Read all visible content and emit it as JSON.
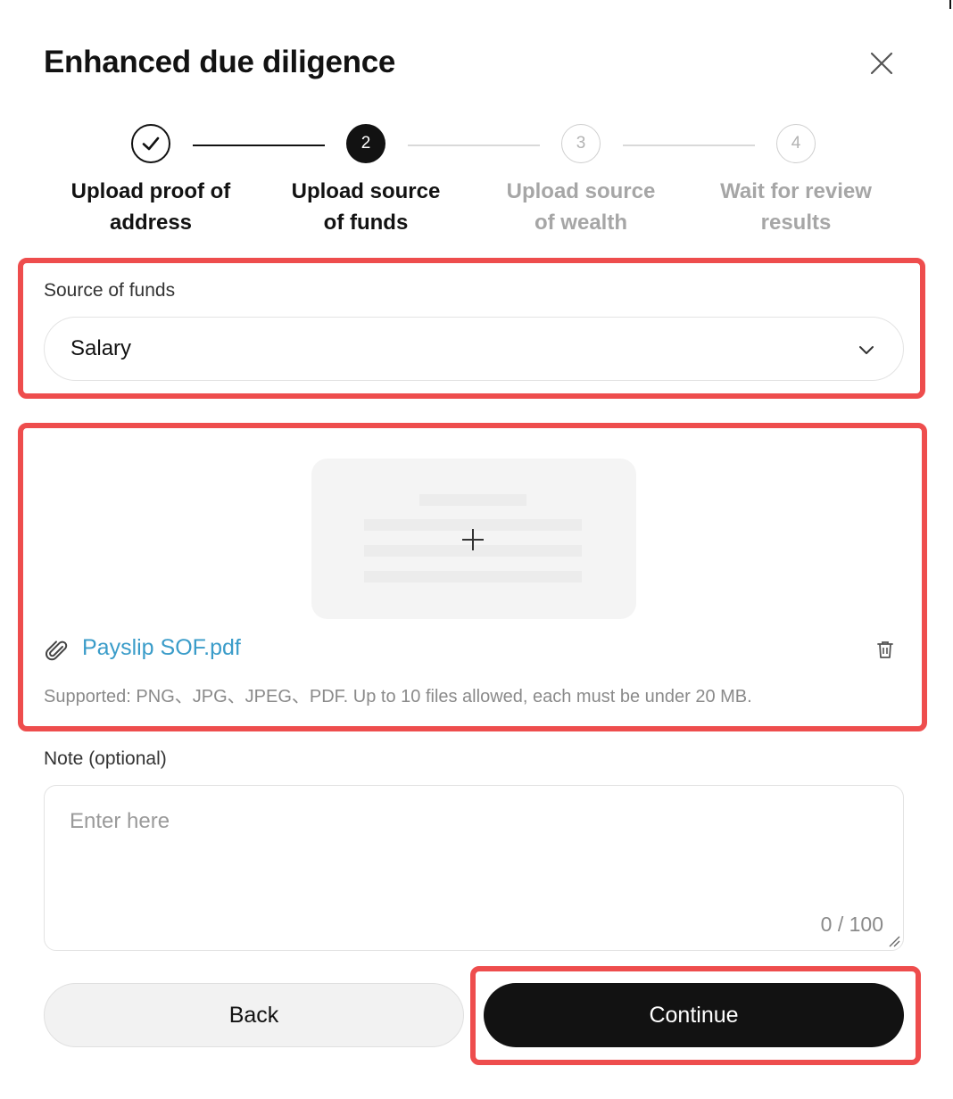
{
  "dialog": {
    "title": "Enhanced due diligence"
  },
  "stepper": {
    "steps": [
      {
        "label_line1": "Upload proof of",
        "label_line2": "address",
        "state": "done",
        "number": "1"
      },
      {
        "label_line1": "Upload source",
        "label_line2": "of funds",
        "state": "active",
        "number": "2"
      },
      {
        "label_line1": "Upload source",
        "label_line2": "of wealth",
        "state": "todo",
        "number": "3"
      },
      {
        "label_line1": "Wait for review",
        "label_line2": "results",
        "state": "todo",
        "number": "4"
      }
    ]
  },
  "source_of_funds": {
    "label": "Source of funds",
    "value": "Salary"
  },
  "upload": {
    "file_name": "Payslip SOF.pdf",
    "supported_text": "Supported: PNG、JPG、JPEG、PDF. Up to 10 files allowed, each must be under 20 MB."
  },
  "note": {
    "label": "Note (optional)",
    "placeholder": "Enter here",
    "counter": "0 / 100"
  },
  "actions": {
    "back_label": "Back",
    "continue_label": "Continue"
  },
  "colors": {
    "primary": "#121212",
    "highlight": "#ee4d4d",
    "link": "#3a9cc9"
  },
  "icons": [
    "close-icon",
    "check-icon",
    "chevron-down-icon",
    "plus-icon",
    "paperclip-icon",
    "trash-icon"
  ]
}
